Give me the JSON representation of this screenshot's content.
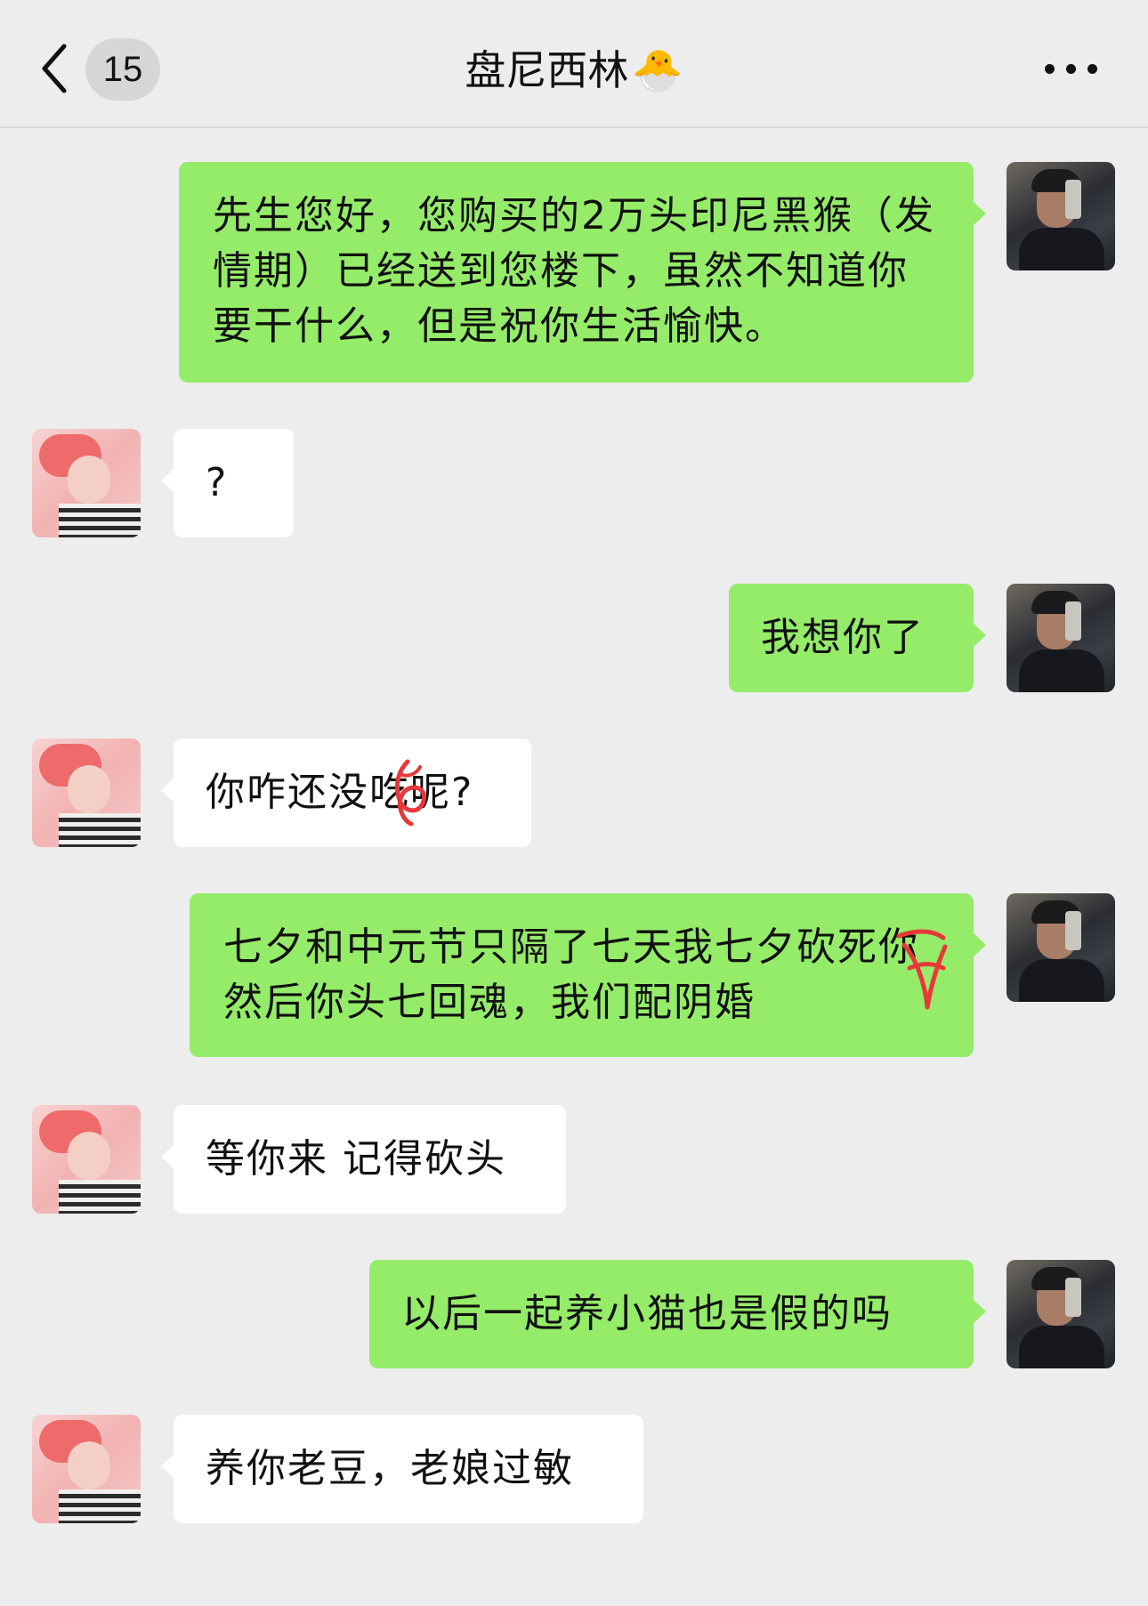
{
  "header": {
    "back_icon": "chevron-left-icon",
    "unread_count": "15",
    "title": "盘尼西林",
    "title_emoji": "🐣",
    "more_icon": "more-dots-icon"
  },
  "messages": [
    {
      "side": "me",
      "text": "先生您好，您购买的2万头印尼黑猴（发情期）已经送到您楼下，虽然不知道你要干什么，但是祝你生活愉快。"
    },
    {
      "side": "them",
      "text": "?"
    },
    {
      "side": "me",
      "text": "我想你了"
    },
    {
      "side": "them",
      "text": "你咋还没吃呢?",
      "note": "one character scribbled over in red"
    },
    {
      "side": "me",
      "text": "七夕和中元节只隔了七天我七夕砍死你然后你头七回魂，我们配阴婚",
      "note": "one character scribbled over in red"
    },
    {
      "side": "them",
      "text": "等你来 记得砍头"
    },
    {
      "side": "me",
      "text": "以后一起养小猫也是假的吗"
    },
    {
      "side": "them",
      "text": "养你老豆，老娘过敏"
    }
  ],
  "colors": {
    "background": "#ededed",
    "my_bubble": "#95ec69",
    "their_bubble": "#ffffff",
    "scribble": "#e8373a"
  }
}
